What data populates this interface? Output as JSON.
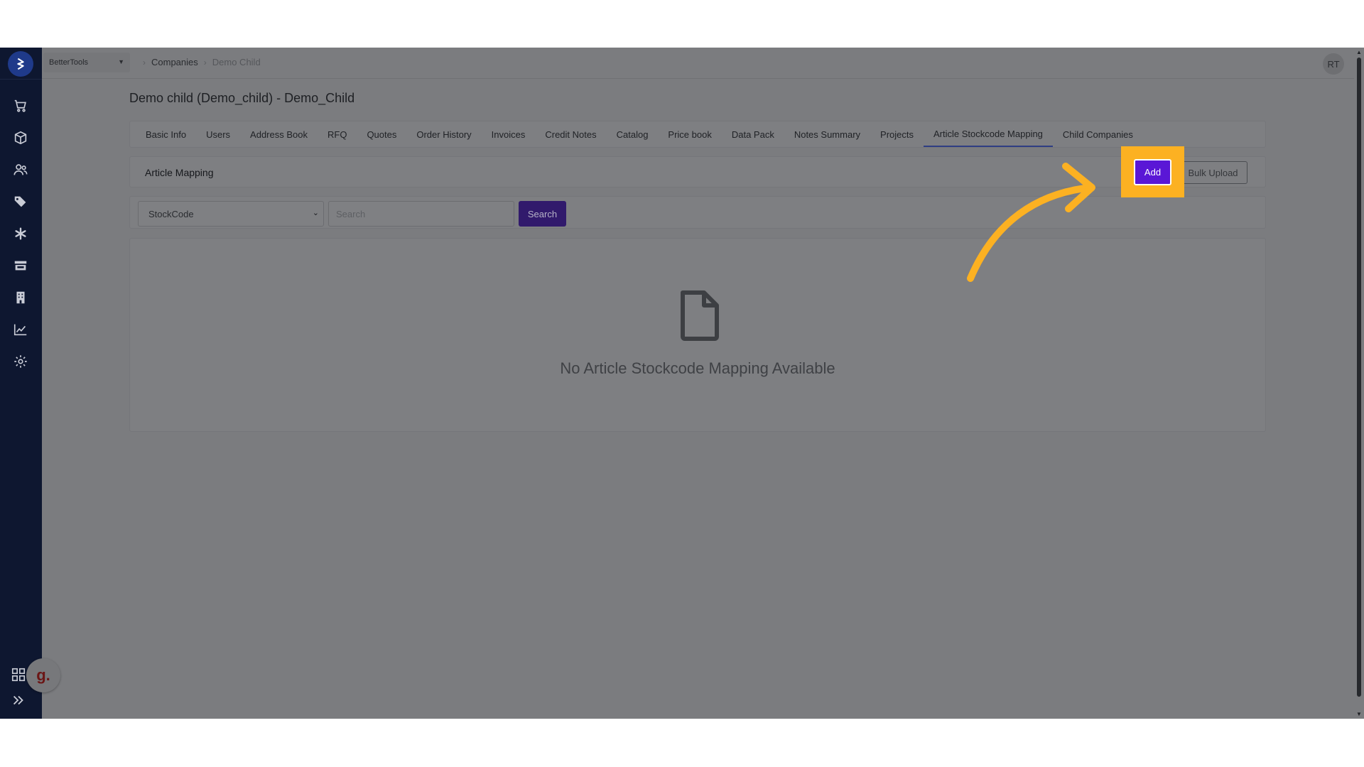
{
  "topbar": {
    "company": "BetterTools",
    "breadcrumb": [
      "Companies",
      "Demo Child"
    ],
    "avatar": "RT"
  },
  "page": {
    "title": "Demo child (Demo_child) - Demo_Child"
  },
  "tabs": [
    {
      "label": "Basic Info",
      "active": false
    },
    {
      "label": "Users",
      "active": false
    },
    {
      "label": "Address Book",
      "active": false
    },
    {
      "label": "RFQ",
      "active": false
    },
    {
      "label": "Quotes",
      "active": false
    },
    {
      "label": "Order History",
      "active": false
    },
    {
      "label": "Invoices",
      "active": false
    },
    {
      "label": "Credit Notes",
      "active": false
    },
    {
      "label": "Catalog",
      "active": false
    },
    {
      "label": "Price book",
      "active": false
    },
    {
      "label": "Data Pack",
      "active": false
    },
    {
      "label": "Notes Summary",
      "active": false
    },
    {
      "label": "Projects",
      "active": false
    },
    {
      "label": "Article Stockcode Mapping",
      "active": true
    },
    {
      "label": "Child Companies",
      "active": false
    }
  ],
  "mapping": {
    "title": "Article Mapping",
    "add_label": "Add",
    "bulk_label": "Bulk Upload"
  },
  "filter": {
    "select_value": "StockCode",
    "search_placeholder": "Search",
    "search_button": "Search"
  },
  "empty": {
    "message": "No Article Stockcode Mapping Available"
  },
  "sidebar": {
    "icons": [
      "cart-icon",
      "box-icon",
      "users-icon",
      "tags-icon",
      "asterisk-icon",
      "store-icon",
      "building-icon",
      "chart-icon",
      "settings-icon"
    ],
    "bottom_icons": [
      "apps-grid-icon",
      "expand-icon"
    ]
  },
  "badge": {
    "letter": "g."
  },
  "colors": {
    "sidebar": "#0e1730",
    "overlay": "#7b7c7f",
    "add_button": "#5a17d6",
    "highlight": "#fcb122",
    "search_button": "#311a6c"
  }
}
